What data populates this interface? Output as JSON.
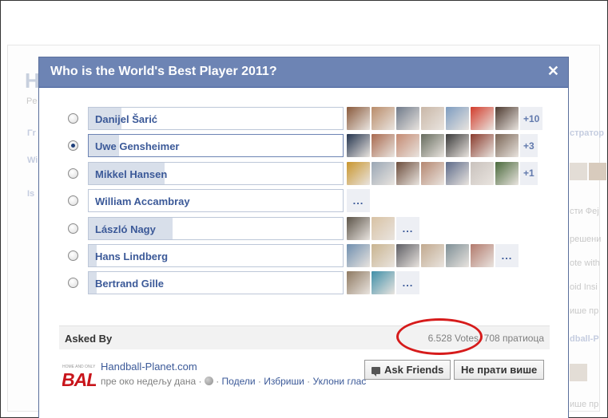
{
  "background": {
    "title": "H",
    "subtitle": "Pe",
    "left_items": [
      "Γr",
      "Wi",
      "Is"
    ],
    "right_items": [
      "стратор",
      "сти Феј",
      "решени",
      "ote with",
      "oid Insi",
      "ише пр",
      "dball-P",
      "ише пр"
    ]
  },
  "dialog": {
    "title": "Who is the World's Best Player 2011?",
    "close_label": "✕"
  },
  "poll": {
    "options": [
      {
        "label": "Danijel Šarić",
        "fill": 0.13,
        "selected": false,
        "faces": [
          "#8a5a3c",
          "#b98c6a",
          "#6f7a8a",
          "#c9b7a7",
          "#7d9cc0",
          "#d23c2c",
          "#4d3a30"
        ],
        "more": "+10"
      },
      {
        "label": "Uwe Gensheimer",
        "fill": 0.12,
        "selected": true,
        "faces": [
          "#24344e",
          "#a96a4f",
          "#c48a72",
          "#666c5e",
          "#3a3a3a",
          "#8a3b2d",
          "#7b6656"
        ],
        "more": "+3"
      },
      {
        "label": "Mikkel Hansen",
        "fill": 0.3,
        "selected": false,
        "faces": [
          "#c9962e",
          "#9aa7b5",
          "#6d4e3d",
          "#b58770",
          "#5d6b8a",
          "#c9c2bd",
          "#4a6a3c"
        ],
        "more": "+1"
      },
      {
        "label": "William Accambray",
        "fill": 0.0,
        "selected": false,
        "faces": [],
        "more": "..."
      },
      {
        "label": "László Nagy",
        "fill": 0.33,
        "selected": false,
        "faces": [
          "#5c5449",
          "#d8c2a4"
        ],
        "more": "..."
      },
      {
        "label": "Hans Lindberg",
        "fill": 0.03,
        "selected": false,
        "faces": [
          "#6f8faf",
          "#c9b490",
          "#5e5e64",
          "#c1a98e",
          "#7e8f96",
          "#b27a6d"
        ],
        "more": "..."
      },
      {
        "label": "Bertrand Gille",
        "fill": 0.03,
        "selected": false,
        "faces": [
          "#8f7a62",
          "#3f8fa8"
        ],
        "more": "..."
      }
    ]
  },
  "asked": {
    "label": "Asked By",
    "votes": "6.528 Votes",
    "separator": "·",
    "followers": "708 пратиоца"
  },
  "footer": {
    "source_logo_small": "HOME AND ONLY",
    "source_logo_big": "BALL",
    "source_name": "Handball-Planet.com",
    "time": "пре око недељу дана",
    "dot": "·",
    "share": "Подели",
    "delete": "Избриши",
    "remove_vote": "Уклони глас",
    "ask_friends": "Ask Friends",
    "unfollow": "Не прати више"
  },
  "colors": {
    "header": "#6d84b4",
    "link": "#3b5998",
    "bar_fill": "#d8dfea",
    "highlight": "#d61b1b"
  },
  "icons": [
    "radio-icon",
    "close-icon",
    "globe-icon",
    "speech-bubble-icon"
  ]
}
